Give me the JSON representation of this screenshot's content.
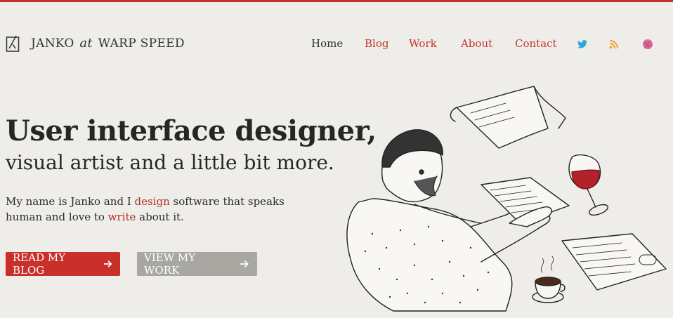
{
  "brand": {
    "part1": "JANKO",
    "part2": "at",
    "part3": "WARP SPEED"
  },
  "nav": {
    "home": "Home",
    "blog": "Blog",
    "work": "Work",
    "about": "About",
    "contact": "Contact"
  },
  "social": [
    "twitter-icon",
    "rss-icon",
    "dribbble-icon"
  ],
  "hero": {
    "title": "User interface designer,",
    "subtitle": "visual artist and a little bit more.",
    "intro_1": "My name is Janko and I ",
    "intro_link1": "design",
    "intro_2": " software that speaks human and love to ",
    "intro_link2": "write",
    "intro_3": " about it."
  },
  "buttons": {
    "primary": "READ MY BLOG",
    "secondary": "VIEW MY WORK"
  },
  "colors": {
    "accent": "#c9302c",
    "background": "#efede9",
    "secondary_button": "#a9a7a1",
    "twitter": "#2ea6d9",
    "rss": "#f0a030",
    "dribbble": "#e46a9a"
  }
}
